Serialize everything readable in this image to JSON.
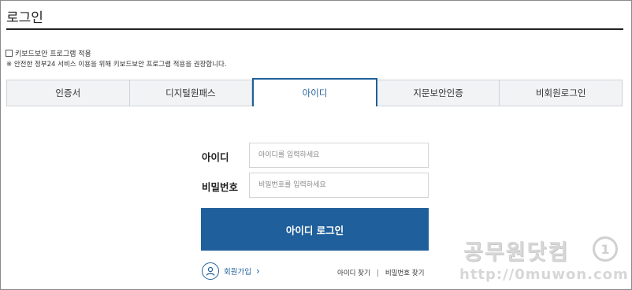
{
  "page": {
    "title": "로그인"
  },
  "keyboard_security": {
    "checkbox_label": "키보드보안 프로그램 적용",
    "checked": false,
    "note": "※ 안전한 정부24 서비스 이용을 위해 키보드보안 프로그램 적용을 권장합니다."
  },
  "tabs": [
    {
      "label": "인증서",
      "active": false
    },
    {
      "label": "디지털원패스",
      "active": false
    },
    {
      "label": "아이디",
      "active": true
    },
    {
      "label": "지문보안인증",
      "active": false
    },
    {
      "label": "비회원로그인",
      "active": false
    }
  ],
  "form": {
    "id_label": "아이디",
    "id_placeholder": "아이디를 입력하세요",
    "pw_label": "비밀번호",
    "pw_placeholder": "비밀번호를 입력하세요",
    "login_button": "아이디 로그인"
  },
  "links": {
    "join": "회원가입",
    "find_id": "아이디 찾기",
    "find_pw": "비밀번호 찾기"
  },
  "watermark": {
    "name": "공무원닷컴",
    "logo_text": "1",
    "url": "http://0muwon.com"
  },
  "colors": {
    "accent": "#1f5f9b",
    "tab_bg": "#f2f3f5",
    "border": "#cfd3d8"
  }
}
